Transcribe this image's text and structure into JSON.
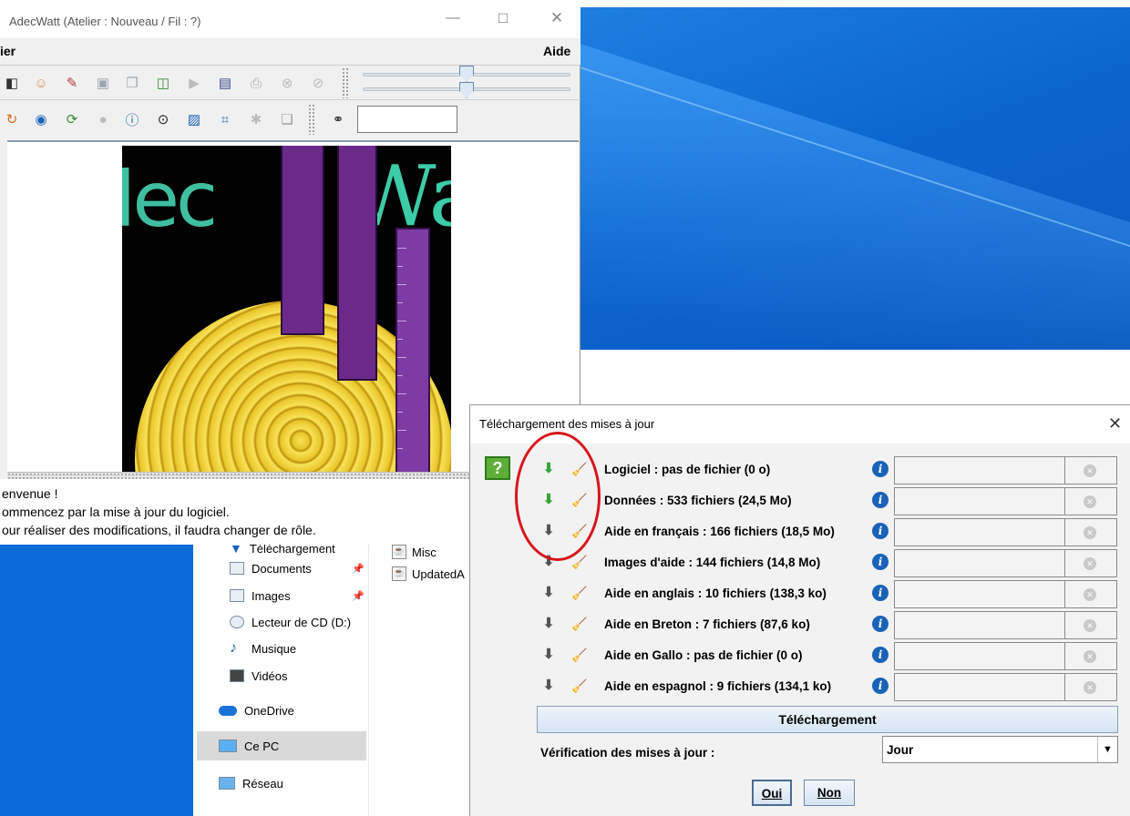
{
  "desktop": {
    "background": "#0c66cf"
  },
  "explorer": {
    "nav_partial_label": "Téléchargement",
    "nav_items": [
      {
        "label": "Documents",
        "pinned": true
      },
      {
        "label": "Images",
        "pinned": true
      },
      {
        "label": "Lecteur de CD (D:)",
        "pinned": false
      },
      {
        "label": "Musique",
        "pinned": false
      },
      {
        "label": "Vidéos",
        "pinned": false
      },
      {
        "label": "OneDrive",
        "pinned": false
      },
      {
        "label": "Ce PC",
        "pinned": false,
        "selected": true
      },
      {
        "label": "Réseau",
        "pinned": false
      }
    ],
    "files": [
      {
        "label": "Misc"
      },
      {
        "label": "UpdatedA"
      }
    ]
  },
  "main_window": {
    "title": "AdecWatt (Atelier : Nouveau / Fil : ?)",
    "menu": {
      "file": "ier",
      "help": "Aide"
    },
    "logo": {
      "left_text": "lec",
      "right_text": "Wa"
    },
    "messages": [
      "envenue !",
      "ommencez par la mise à jour du logiciel.",
      "our réaliser des modifications, il faudra changer de rôle."
    ]
  },
  "dialog": {
    "title": "Téléchargement des mises à jour",
    "help_label": "?",
    "rows": [
      {
        "label": "Logiciel :  pas de fichier (0 o)",
        "download_enabled": true
      },
      {
        "label": "Données :  533 fichiers (24,5 Mo)",
        "download_enabled": true
      },
      {
        "label": "Aide en français :  166 fichiers (18,5 Mo)",
        "download_enabled": false
      },
      {
        "label": "Images d'aide :  144 fichiers (14,8 Mo)",
        "download_enabled": false
      },
      {
        "label": "Aide en anglais :  10 fichiers (138,3 ko)",
        "download_enabled": false
      },
      {
        "label": "Aide en Breton :  7 fichiers (87,6 ko)",
        "download_enabled": false
      },
      {
        "label": "Aide en Gallo :  pas de fichier (0 o)",
        "download_enabled": false
      },
      {
        "label": "Aide en espagnol :  9 fichiers (134,1 ko)",
        "download_enabled": false
      }
    ],
    "download_button": "Téléchargement",
    "verification_label": "Vérification des mises à jour :",
    "frequency_value": "Jour",
    "ok_button": "Oui",
    "no_button": "Non"
  },
  "annotation": {
    "color": "#d8141c"
  }
}
